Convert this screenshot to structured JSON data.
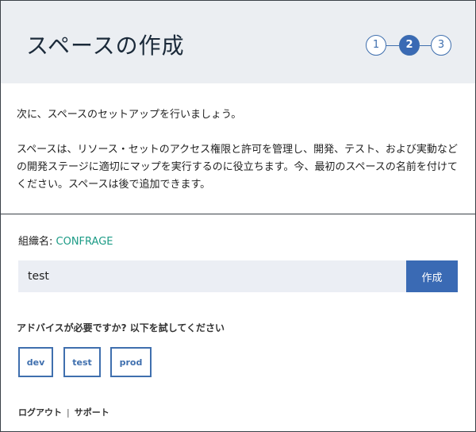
{
  "header": {
    "title": "スペースの作成"
  },
  "stepper": {
    "steps": [
      "1",
      "2",
      "3"
    ],
    "current": 2
  },
  "content": {
    "intro": "次に、スペースのセットアップを行いましょう。",
    "description": "スペースは、リソース・セットのアクセス権限と許可を管理し、開発、テスト、および実動などの開発ステージに適切にマップを実行するのに役立ちます。今、最初のスペースの名前を付けてください。スペースは後で追加できます。"
  },
  "org": {
    "label": "組織名: ",
    "value": "CONFRAGE"
  },
  "form": {
    "space_name_value": "test",
    "create_label": "作成"
  },
  "advice": {
    "text": "アドバイスが必要ですか? 以下を試してください",
    "suggestions": [
      "dev",
      "test",
      "prod"
    ]
  },
  "footer": {
    "logout": "ログアウト",
    "separator": "|",
    "support": "サポート"
  },
  "colors": {
    "accent": "#3a6ab4",
    "org_value": "#1c9b86",
    "header_bg": "#ebeef2",
    "input_bg": "#ebeef4"
  }
}
